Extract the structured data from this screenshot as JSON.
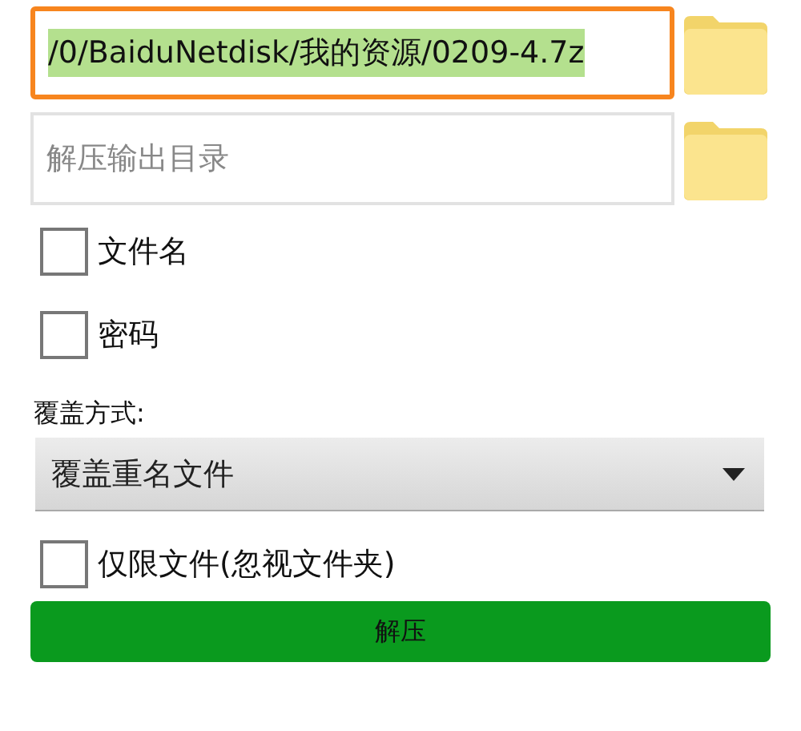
{
  "source_field": {
    "value": "/0/BaiduNetdisk/我的资源/0209-4.7z",
    "focused": true,
    "text_selected": true
  },
  "output_field": {
    "placeholder": "解压输出目录"
  },
  "options": [
    {
      "label": "文件名",
      "checked": false
    },
    {
      "label": "密码",
      "checked": false
    }
  ],
  "overwrite": {
    "label": "覆盖方式:",
    "value": "覆盖重名文件"
  },
  "files_only": {
    "label": "仅限文件(忽视文件夹)",
    "checked": false
  },
  "extract_button": "解压"
}
